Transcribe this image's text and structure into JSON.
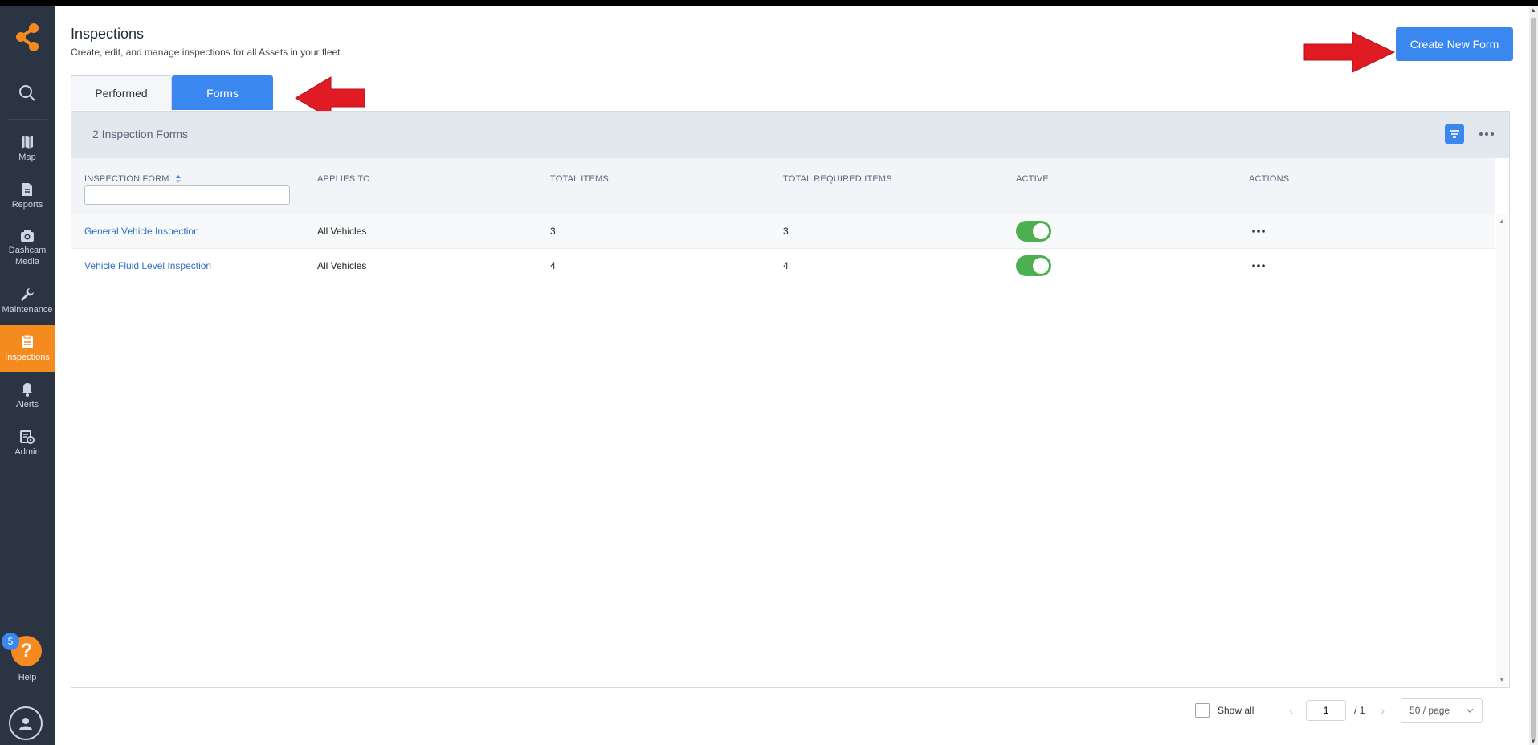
{
  "colors": {
    "sidebar_bg": "#2b3443",
    "accent_orange": "#f58a1f",
    "primary_blue": "#3b87f0",
    "toggle_green": "#4caf50",
    "annotation_red": "#e01b24"
  },
  "sidebar": {
    "logo_icon": "share-nodes-logo",
    "search_icon": "search-icon",
    "items": [
      {
        "label": "Map",
        "icon": "map-icon"
      },
      {
        "label": "Reports",
        "icon": "document-icon"
      },
      {
        "label": "Dashcam Media",
        "icon": "camera-icon"
      },
      {
        "label": "Maintenance",
        "icon": "wrench-icon"
      },
      {
        "label": "Inspections",
        "icon": "clipboard-icon",
        "active": true
      },
      {
        "label": "Alerts",
        "icon": "bell-icon"
      },
      {
        "label": "Admin",
        "icon": "admin-settings-icon"
      }
    ],
    "help": {
      "badge": "5",
      "symbol": "?",
      "label": "Help"
    },
    "user_icon": "user-icon"
  },
  "header": {
    "title": "Inspections",
    "subtitle": "Create, edit, and manage inspections for all Assets in your fleet.",
    "create_button": "Create New Form"
  },
  "tabs": [
    {
      "label": "Performed",
      "active": false
    },
    {
      "label": "Forms",
      "active": true
    }
  ],
  "panel": {
    "count_label": "2 Inspection Forms"
  },
  "table": {
    "columns": [
      "INSPECTION FORM",
      "APPLIES TO",
      "TOTAL ITEMS",
      "TOTAL REQUIRED ITEMS",
      "ACTIVE",
      "ACTIONS"
    ],
    "filter_value": "",
    "rows": [
      {
        "name": "General Vehicle Inspection",
        "applies_to": "All Vehicles",
        "total_items": "3",
        "total_required": "3",
        "active": true
      },
      {
        "name": "Vehicle Fluid Level Inspection",
        "applies_to": "All Vehicles",
        "total_items": "4",
        "total_required": "4",
        "active": true
      }
    ]
  },
  "pagination": {
    "show_all_label": "Show all",
    "current_page": "1",
    "total_pages": "/ 1",
    "per_page": "50 / page"
  }
}
